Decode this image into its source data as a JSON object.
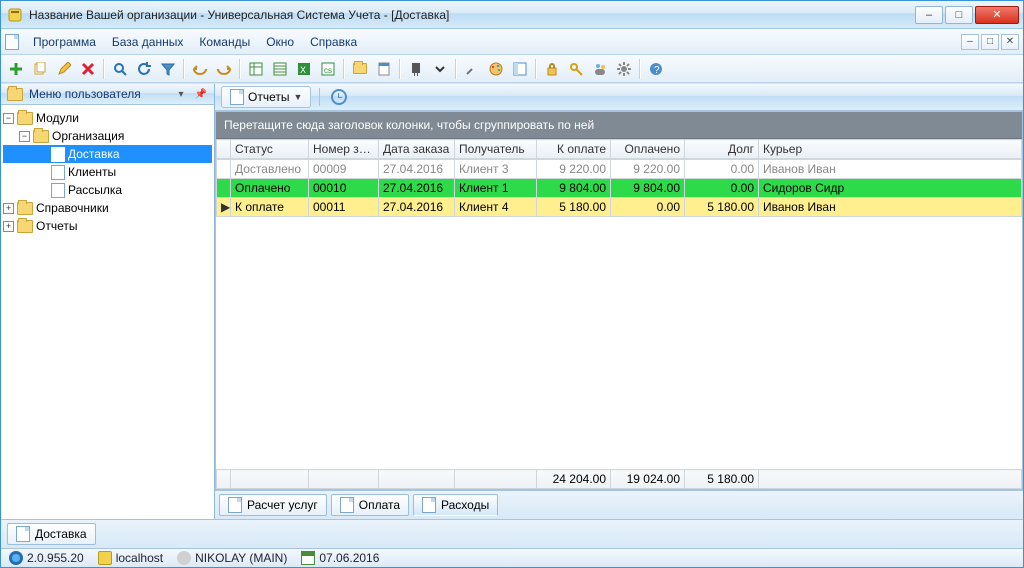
{
  "titlebar": {
    "title": "Название Вашей организации - Универсальная Система Учета - [Доставка]"
  },
  "menu": {
    "items": [
      "Программа",
      "База данных",
      "Команды",
      "Окно",
      "Справка"
    ]
  },
  "sidebar": {
    "title": "Меню пользователя",
    "tree": {
      "modules": "Модули",
      "organization": "Организация",
      "delivery": "Доставка",
      "clients": "Клиенты",
      "mailing": "Рассылка",
      "catalogs": "Справочники",
      "reports": "Отчеты"
    }
  },
  "content": {
    "reports_btn": "Отчеты",
    "group_hint": "Перетащите сюда заголовок колонки, чтобы сгруппировать по ней",
    "columns": [
      "Статус",
      "Номер заказа",
      "Дата заказа",
      "Получатель",
      "К оплате",
      "Оплачено",
      "Долг",
      "Курьер"
    ],
    "rows": [
      {
        "kind": "delivered",
        "status": "Доставлено",
        "num": "00009",
        "date": "27.04.2016",
        "recipient": "Клиент 3",
        "to_pay": "9 220.00",
        "paid": "9 220.00",
        "debt": "0.00",
        "courier": "Иванов Иван"
      },
      {
        "kind": "paid",
        "status": "Оплачено",
        "num": "00010",
        "date": "27.04.2016",
        "recipient": "Клиент 1",
        "to_pay": "9 804.00",
        "paid": "9 804.00",
        "debt": "0.00",
        "courier": "Сидоров Сидр"
      },
      {
        "kind": "selected",
        "status": "К оплате",
        "num": "00011",
        "date": "27.04.2016",
        "recipient": "Клиент 4",
        "to_pay": "5 180.00",
        "paid": "0.00",
        "debt": "5 180.00",
        "courier": "Иванов Иван"
      }
    ],
    "totals": {
      "to_pay": "24 204.00",
      "paid": "19 024.00",
      "debt": "5 180.00"
    },
    "bottom_tabs": [
      "Расчет услуг",
      "Оплата",
      "Расходы"
    ]
  },
  "taskbar": {
    "tab": "Доставка"
  },
  "status": {
    "version": "2.0.955.20",
    "host": "localhost",
    "user": "NIKOLAY (MAIN)",
    "date": "07.06.2016"
  }
}
